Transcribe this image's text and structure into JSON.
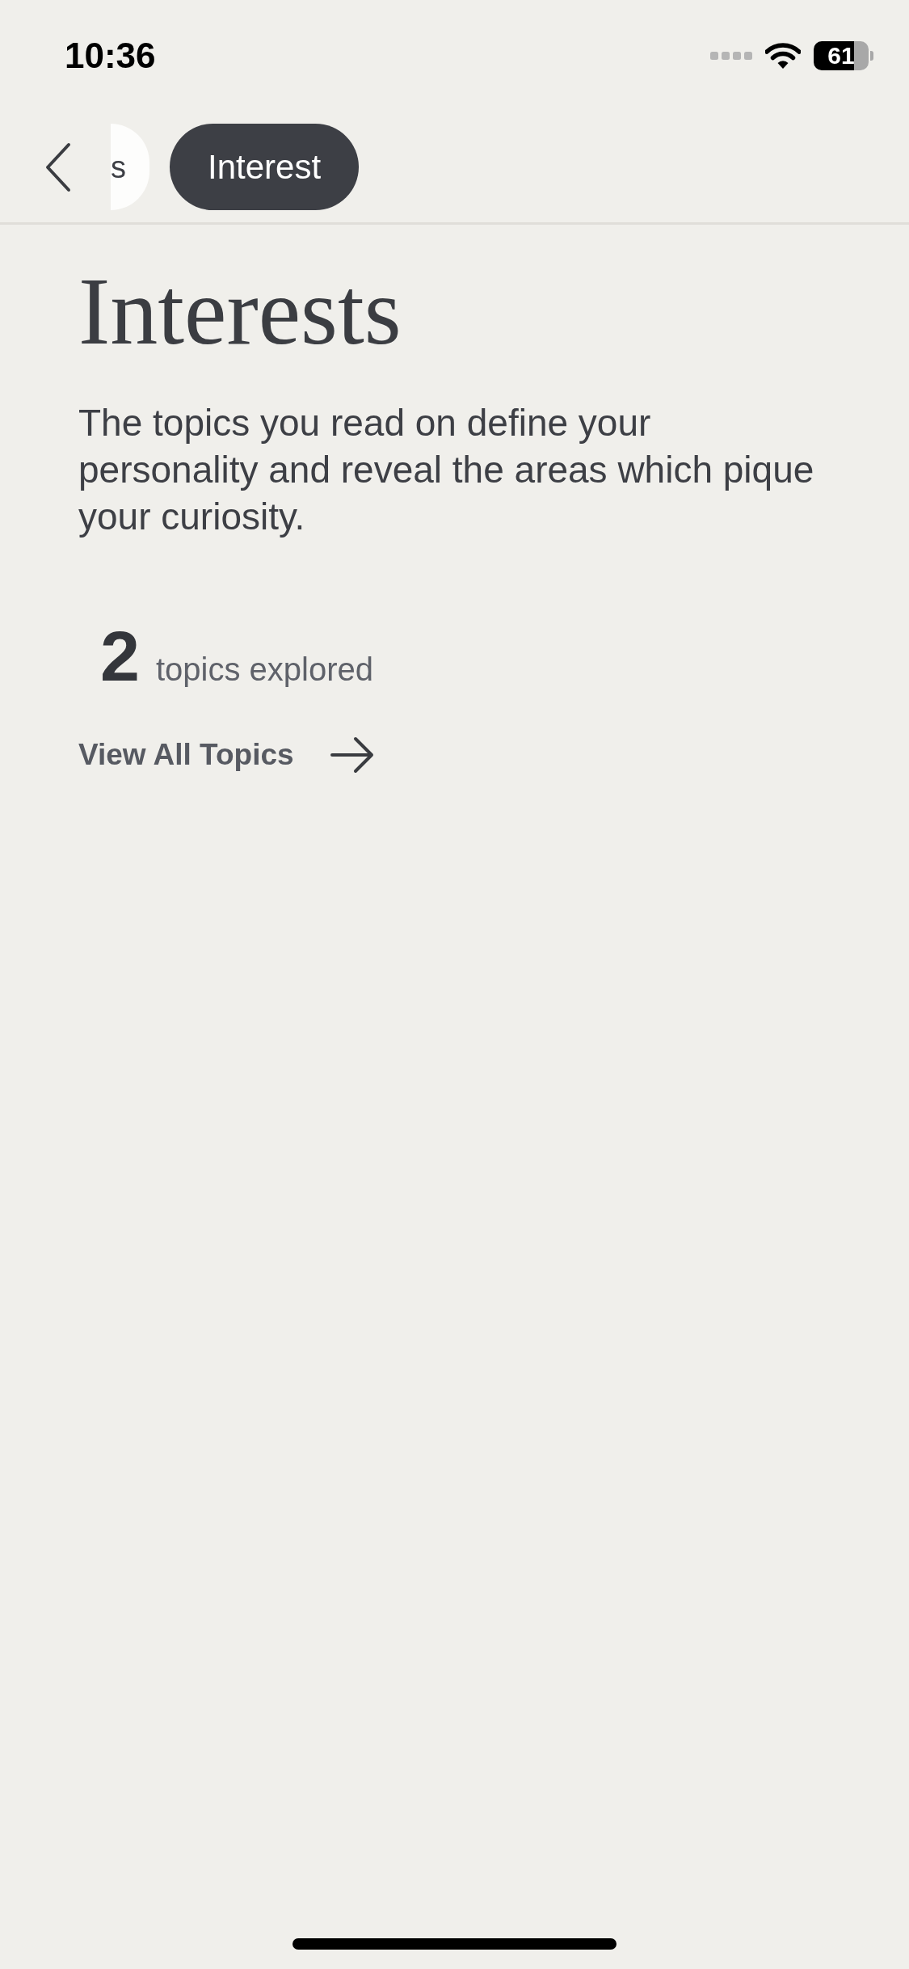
{
  "status_bar": {
    "time": "10:36",
    "battery": "61"
  },
  "nav": {
    "tabs": [
      {
        "label": "s",
        "selected": false
      },
      {
        "label": "Interest",
        "selected": true
      }
    ]
  },
  "title": "Interests",
  "description": "The topics you read on define your personality and reveal the areas which pique your curiosity.",
  "stats": {
    "count": "2",
    "label": "topics explored"
  },
  "link": {
    "label": "View All Topics"
  }
}
